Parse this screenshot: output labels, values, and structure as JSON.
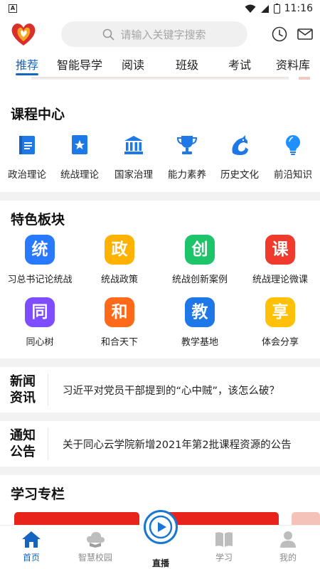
{
  "status_bar": {
    "time": "11:16",
    "battery_level": "1"
  },
  "search": {
    "placeholder": "请输入关键字搜索"
  },
  "tabs": [
    {
      "label": "推荐",
      "active": true
    },
    {
      "label": "智能导学"
    },
    {
      "label": "阅读"
    },
    {
      "label": "班级"
    },
    {
      "label": "考试"
    },
    {
      "label": "资料库"
    }
  ],
  "course_center": {
    "title": "课程中心",
    "items": [
      {
        "label": "政治理论",
        "icon": "document-book-icon"
      },
      {
        "label": "统战理论",
        "icon": "star-book-icon"
      },
      {
        "label": "国家治理",
        "icon": "government-building-icon"
      },
      {
        "label": "能力素养",
        "icon": "trophy-icon"
      },
      {
        "label": "历史文化",
        "icon": "dragon-icon"
      },
      {
        "label": "前沿知识",
        "icon": "lightbulb-icon"
      }
    ]
  },
  "featured": {
    "title": "特色板块",
    "items": [
      {
        "char": "统",
        "label": "习总书记论统战",
        "color": "#2979ff"
      },
      {
        "char": "政",
        "label": "统战政策",
        "color": "#ffb300"
      },
      {
        "char": "创",
        "label": "统战创新案例",
        "color": "#1ec46a"
      },
      {
        "char": "课",
        "label": "统战理论微课",
        "color": "#f03a2e"
      },
      {
        "char": "同",
        "label": "同心树",
        "color": "#7e4dff"
      },
      {
        "char": "和",
        "label": "和合天下",
        "color": "#ff6a1a"
      },
      {
        "char": "教",
        "label": "教学基地",
        "color": "#1e78e8"
      },
      {
        "char": "享",
        "label": "体会分享",
        "color": "#ffc107"
      }
    ]
  },
  "news": {
    "tag_line1": "新闻",
    "tag_line2": "资讯",
    "text": "习近平对党员干部提到的“心中贼”，该怎么破？"
  },
  "notice": {
    "tag_line1": "通知",
    "tag_line2": "公告",
    "text": "关于同心云学院新增2021年第2批课程资源的公告"
  },
  "study": {
    "title": "学习专栏"
  },
  "bottom_nav": {
    "items": [
      {
        "label": "首页",
        "active": true
      },
      {
        "label": "智慧校园"
      },
      {
        "label": "直播"
      },
      {
        "label": "学习"
      },
      {
        "label": "我的"
      }
    ]
  },
  "colors": {
    "accent": "#1565c0",
    "background": "#f2f2f2"
  }
}
